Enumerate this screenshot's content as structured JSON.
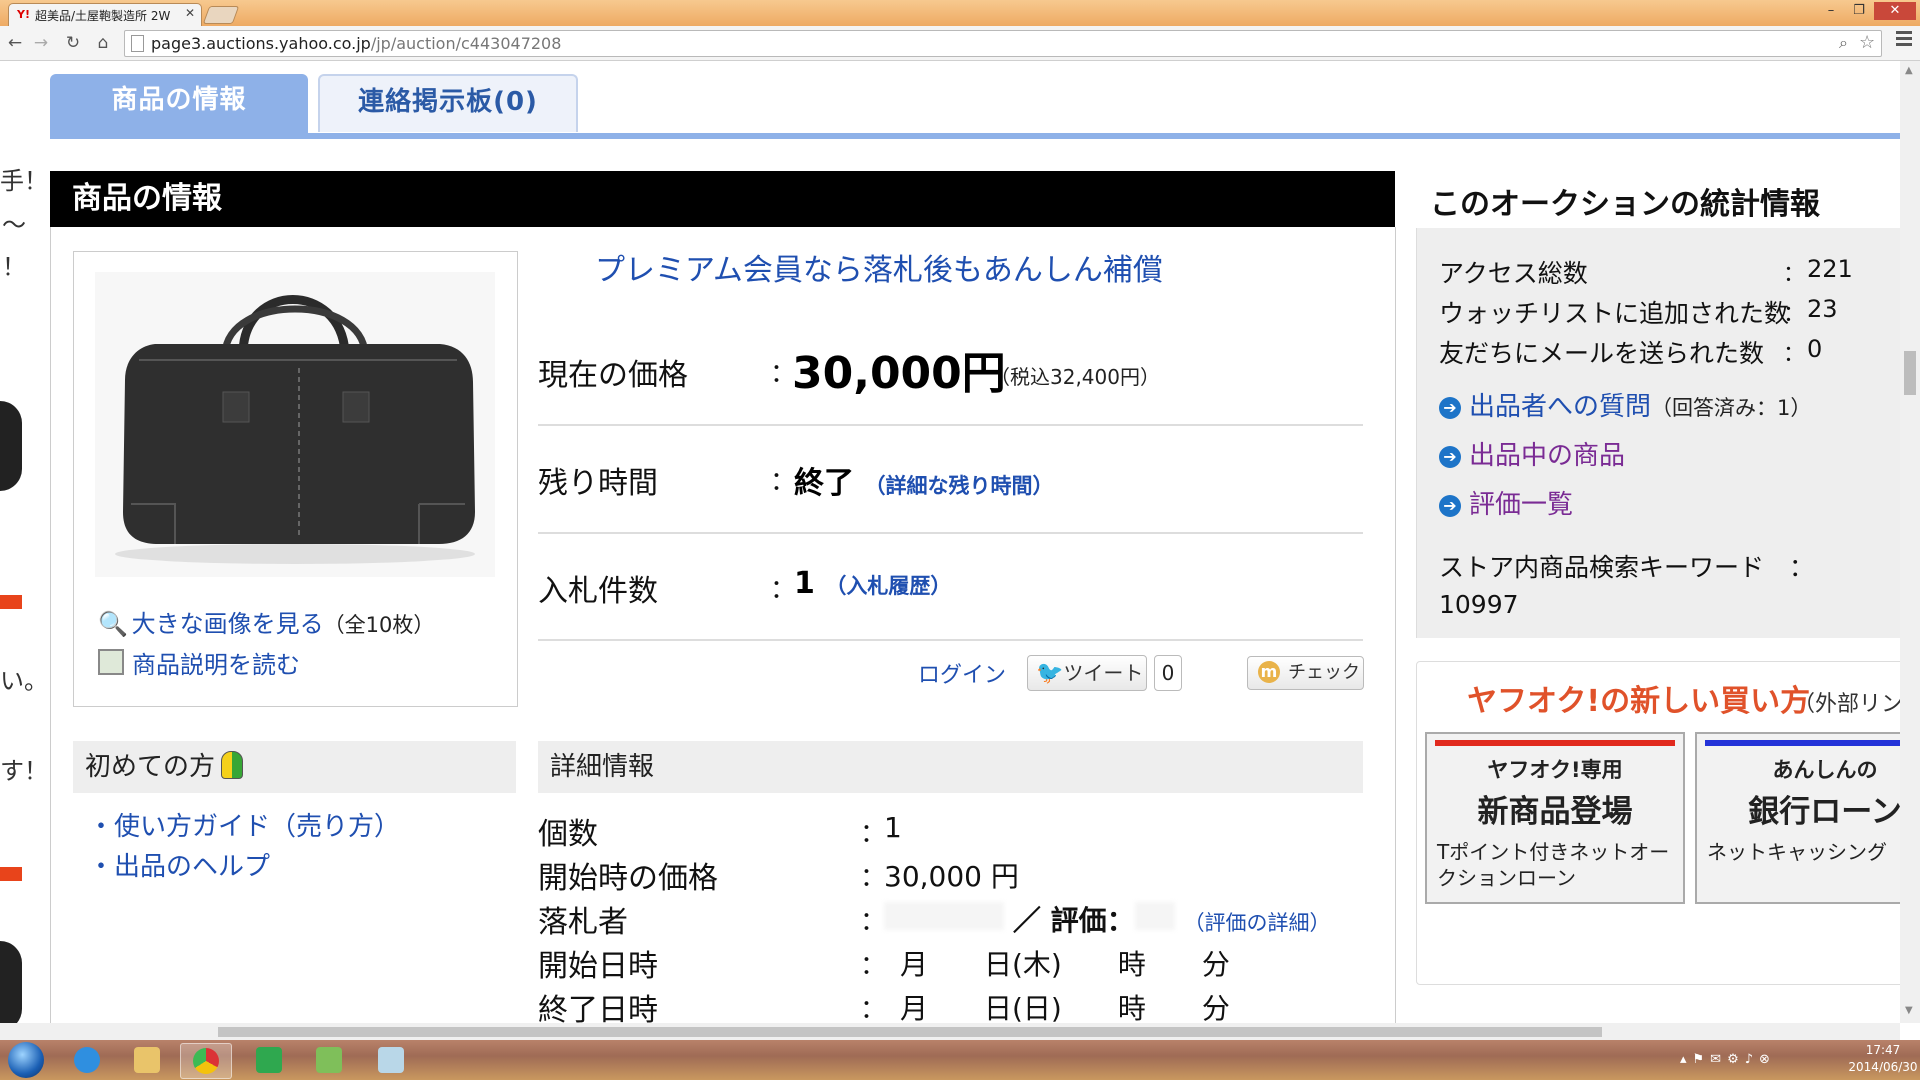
{
  "browser": {
    "tab_title": "超美品/土屋鞄製造所 2W",
    "tab_favicon": "Y!",
    "url_domain": "page3.auctions.yahoo.co.jp",
    "url_path": "/jp/auction/c443047208"
  },
  "tabs": {
    "item_info": "商品の情報",
    "board": "連絡掲示板(0)"
  },
  "section_title": "商品の情報",
  "image_box": {
    "large_image_link": "大きな画像を見る",
    "large_image_count": "（全10枚）",
    "description_link": "商品説明を読む"
  },
  "premium_link": "プレミアム会員なら落札後もあんしん補償",
  "price": {
    "label": "現在の価格",
    "colon": "：",
    "value": "30,000円",
    "tax_note": "（税込32,400円）"
  },
  "time_left": {
    "label": "残り時間",
    "value": "終了",
    "link": "（詳細な残り時間）"
  },
  "bids": {
    "label": "入札件数",
    "value": "1",
    "link": "（入札履歴）"
  },
  "social": {
    "login": "ログイン",
    "tweet": "ツイート",
    "tweet_count": "0",
    "check": "チェック"
  },
  "first_time": {
    "header": "初めての方",
    "links": [
      "使い方ガイド（売り方）",
      "出品のヘルプ"
    ],
    "bullet": "・"
  },
  "detail": {
    "header": "詳細情報",
    "quantity_label": "個数",
    "quantity_value": "1",
    "start_price_label": "開始時の価格",
    "start_price_value": "30,000 円",
    "winner_label": "落札者",
    "rating_label": "／ 評価：",
    "rating_link": "（評価の詳細）",
    "start_date_label": "開始日時",
    "start_date_value": "月　　日(木)　　時　　分",
    "end_date_label": "終了日時",
    "end_date_value": "月　　日(日)　　時　　分"
  },
  "stats": {
    "title": "このオークションの統計情報",
    "access_label": "アクセス総数",
    "access_value": "221",
    "watch_label": "ウォッチリストに追加された数",
    "watch_value": "23",
    "mail_label": "友だちにメールを送られた数",
    "mail_value": "0",
    "question_link": "出品者への質問",
    "question_note": "（回答済み：1）",
    "listing_link": "出品中の商品",
    "rating_list_link": "評価一覧",
    "keyword_label": "ストア内商品検索キーワード",
    "keyword_value": "10997"
  },
  "new_ways": {
    "title": "ヤフオク!の新しい買い方",
    "external": "（外部リンク",
    "promo1": {
      "line1": "ヤフオク!専用",
      "line2": "新商品登場",
      "line3": "Tポイント付きネットオークションローン",
      "bar_color": "#e12a1e"
    },
    "promo2": {
      "line1": "あんしんの",
      "line2": "銀行ローン",
      "line3": "ネットキャッシング",
      "bar_color": "#2433d8"
    }
  },
  "fragments": [
    "手！",
    "〜",
    "！",
    "い。",
    "す！"
  ],
  "taskbar": {
    "time": "17:47",
    "date": "2014/06/30"
  },
  "colors": {
    "tab_active": "#8eb1e8",
    "link": "#1f4fb0",
    "accent_orange": "#e0522a",
    "visited_purple": "#7a2b94"
  }
}
